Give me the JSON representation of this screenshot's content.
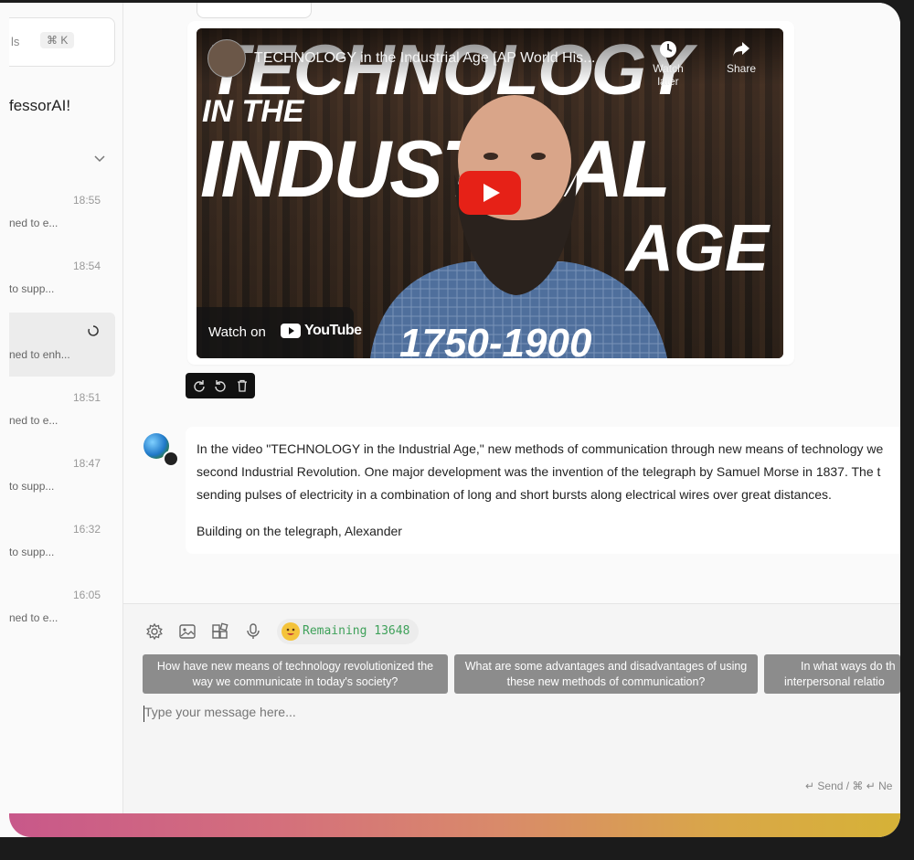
{
  "sidebar": {
    "search_text": "ls",
    "shortcut": "⌘ K",
    "welcome": "fessorAI!",
    "conversations": [
      {
        "time": "18:55",
        "snippet": "ned to e..."
      },
      {
        "time": "18:54",
        "snippet": "to supp..."
      },
      {
        "time": "",
        "snippet": "ned to enh..."
      },
      {
        "time": "18:51",
        "snippet": "ned to e..."
      },
      {
        "time": "18:47",
        "snippet": "to supp..."
      },
      {
        "time": "16:32",
        "snippet": "to supp..."
      },
      {
        "time": "16:05",
        "snippet": "ned to e..."
      }
    ]
  },
  "video": {
    "title": "TECHNOLOGY in the Industrial Age [AP World His...",
    "watch_later": "Watch later",
    "share": "Share",
    "watch_on": "Watch on",
    "youtube": "YouTube",
    "thumb_line1": "TECHNOLOGY",
    "thumb_line2": "IN THE",
    "thumb_line3": "INDUSTRIAL",
    "thumb_line4": "AGE",
    "thumb_line5": "1750-1900"
  },
  "answer": {
    "para1_line1": "In the video \"TECHNOLOGY in the Industrial Age,\" new methods of communication through new means of technology we",
    "para1_line2": "second Industrial Revolution. One major development was the invention of the telegraph by Samuel Morse in 1837. The t",
    "para1_line3": "sending pulses of electricity in a combination of long and short bursts along electrical wires over great distances.",
    "para2": "Building on the telegraph, Alexander"
  },
  "composer": {
    "remaining": "Remaining 13648",
    "suggestions": [
      {
        "line1": "How have new means of technology revolutionized the",
        "line2": "way we communicate in today's society?"
      },
      {
        "line1": "What are some advantages and disadvantages of using",
        "line2": "these new methods of communication?"
      },
      {
        "line1": "In what ways do th",
        "line2": "interpersonal relatio"
      }
    ],
    "placeholder": "Type your message here...",
    "send_hint": "↵ Send / ⌘ ↵ Ne"
  },
  "colors": {
    "remaining_text": "#3fa15a",
    "youtube_red": "#e62117",
    "suggestion_bg": "#8c8c8c"
  }
}
